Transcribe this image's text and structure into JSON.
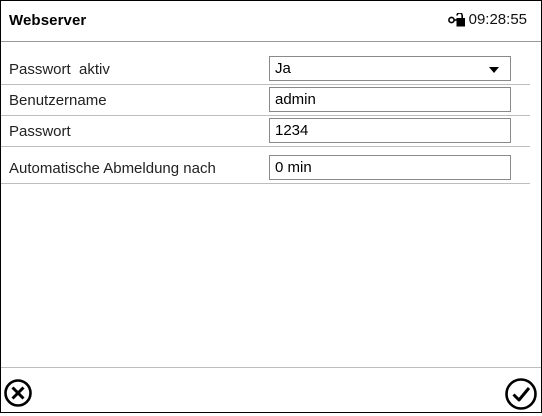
{
  "header": {
    "title": "Webserver",
    "time": "09:28:55",
    "status_icon": "lock-open-icon"
  },
  "rows": [
    {
      "label": "Passwort  aktiv",
      "value": "Ja",
      "type": "dropdown"
    },
    {
      "label": "Benutzername",
      "value": "admin",
      "type": "text"
    },
    {
      "label": "Passwort",
      "value": "1234",
      "type": "text"
    },
    {
      "label": "Automatische Abmeldung nach",
      "value": "0 min",
      "type": "text"
    }
  ],
  "footer": {
    "cancel_icon": "cancel-circle-x-icon",
    "confirm_icon": "confirm-checkmark-icon"
  }
}
